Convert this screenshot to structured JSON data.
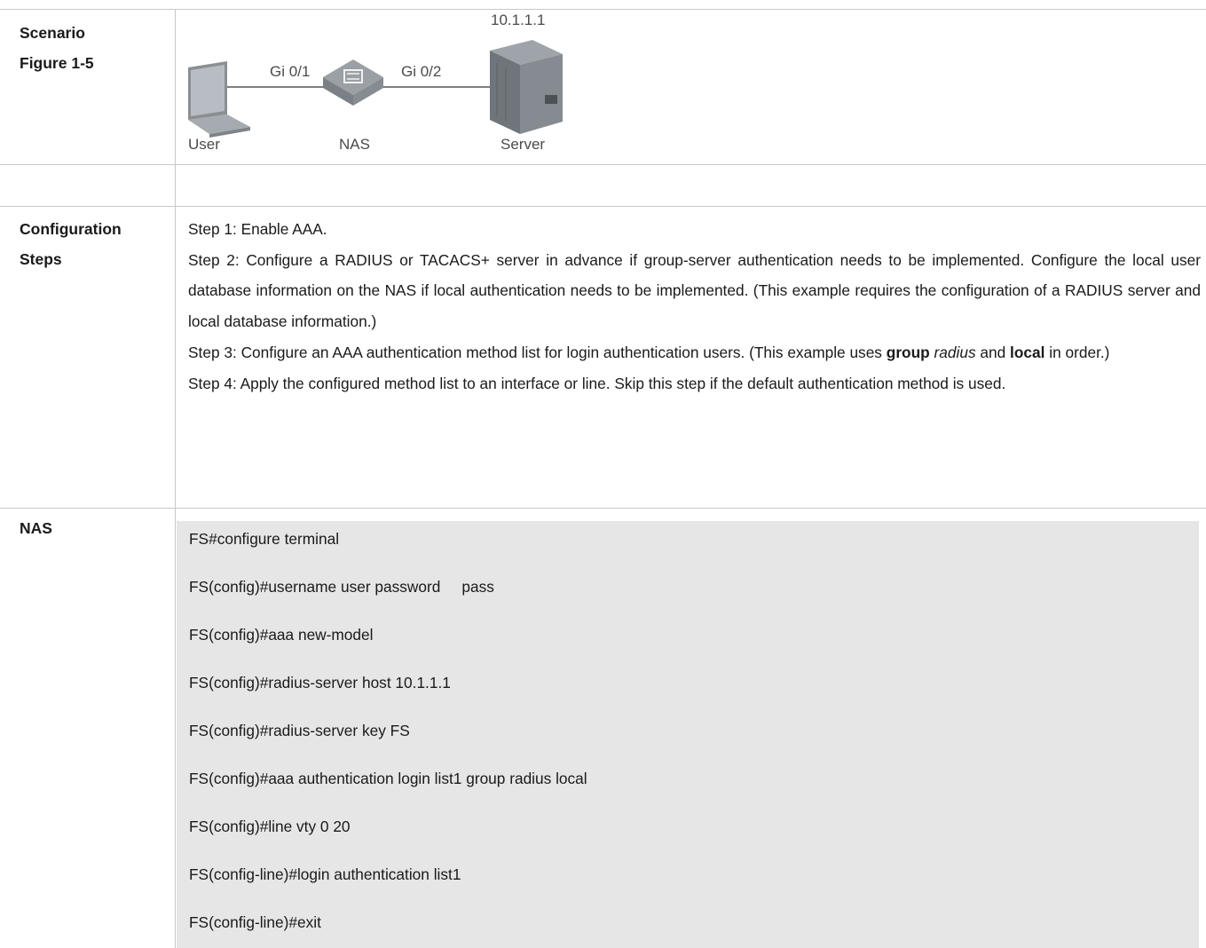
{
  "rows": {
    "scenario": {
      "label_line1": "Scenario",
      "label_line2": "Figure 1-5",
      "diagram": {
        "server_ip": "10.1.1.1",
        "port_left": "Gi 0/1",
        "port_right": "Gi 0/2",
        "node_user": "User",
        "node_nas": "NAS",
        "node_server": "Server",
        "icons": [
          "laptop-icon",
          "switch-icon",
          "server-icon"
        ]
      }
    },
    "config": {
      "label_line1": "Configuration",
      "label_line2": "Steps",
      "step1": "Step 1: Enable AAA.",
      "step2": "Step 2: Configure a RADIUS or TACACS+ server in advance if group-server authentication needs to be implemented. Configure the local user database information on the NAS if local authentication needs to be implemented. (This example requires the configuration of a RADIUS server and local database information.)",
      "step3_a": "Step 3: Configure an AAA authentication method list for login authentication users. (This example uses ",
      "step3_b": "group",
      "step3_c": "radius",
      "step3_d": " and ",
      "step3_e": "local",
      "step3_f": " in order.)",
      "step4": "Step 4: Apply the configured method list to an interface or line. Skip this step if the default authentication method is used."
    },
    "nas": {
      "label": "NAS",
      "code": [
        "FS#configure terminal",
        "FS(config)#username user password     pass",
        "FS(config)#aaa new-model",
        "FS(config)#radius-server host 10.1.1.1",
        "FS(config)#radius-server key FS",
        "FS(config)#aaa authentication login list1 group radius local",
        "FS(config)#line vty 0 20",
        "FS(config-line)#login authentication list1",
        "FS(config-line)#exit"
      ]
    }
  }
}
